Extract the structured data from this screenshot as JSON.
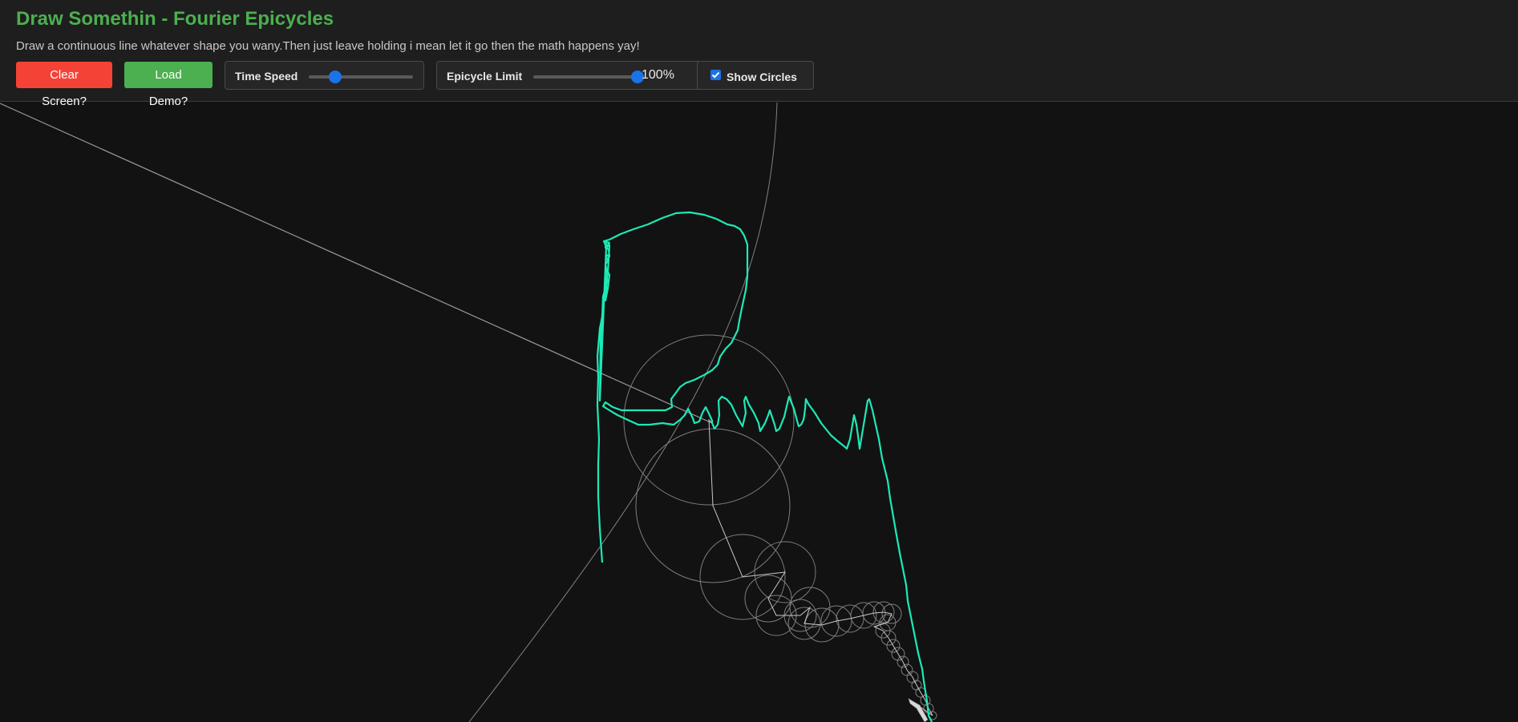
{
  "header": {
    "title": "Draw Somethin - Fourier Epicycles",
    "subtitle": "Draw a continuous line whatever shape you wany.Then just leave holding i mean let it go then the math happens yay!"
  },
  "controls": {
    "clear_label": "Clear Screen?",
    "demo_label": "Load Demo?",
    "speed_label": "Time Speed",
    "speed_value": 0.25,
    "epicycle_label": "Epicycle Limit",
    "epicycle_value": 1.0,
    "epicycle_value_text": "100%",
    "circles_label": "Show Circles",
    "circles_checked": true
  },
  "colors": {
    "accent_green": "#4caf50",
    "danger_red": "#f44336",
    "slider_blue": "#1a73e8",
    "path_cyan": "#1de9b6",
    "circle_gray": "#8a8a8a"
  }
}
